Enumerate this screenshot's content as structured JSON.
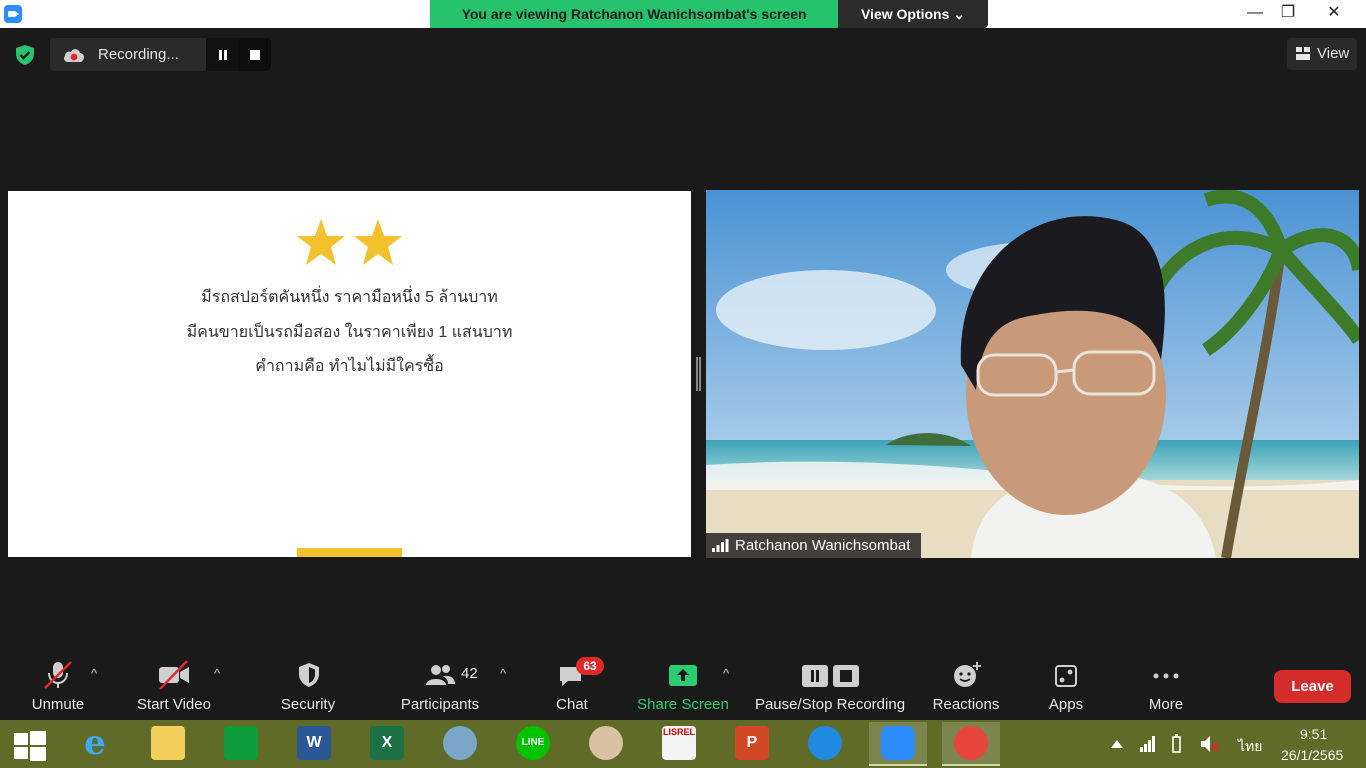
{
  "window": {
    "banner_text": "You are viewing Ratchanon Wanichsombat's screen",
    "view_options_label": "View Options ⌄",
    "minimize_glyph": "—",
    "maximize_glyph": "❐",
    "close_glyph": "✕"
  },
  "recording": {
    "label": "Recording...",
    "icons": [
      "security-shield-icon",
      "cloud-recording-icon",
      "pause-icon",
      "stop-icon"
    ]
  },
  "view_button": {
    "label": "View"
  },
  "shared_slide": {
    "star_count": 2,
    "lines": [
      "มีรถสปอร์ตคันหนึ่ง ราคามือหนึ่ง 5 ล้านบาท",
      "มีคนขายเป็นรถมือสอง ในราคาเพียง 1 แสนบาท",
      "คำถามคือ ทำไมไม่มีใครซื้อ"
    ],
    "accent_color": "#f3c12b"
  },
  "video": {
    "participant_name": "Ratchanon Wanichsombat"
  },
  "toolbar": {
    "unmute": "Unmute",
    "start_video": "Start Video",
    "security": "Security",
    "participants": "Participants",
    "participants_count": "42",
    "chat": "Chat",
    "chat_badge": "63",
    "share_screen": "Share Screen",
    "pause_stop_recording": "Pause/Stop Recording",
    "reactions": "Reactions",
    "apps": "Apps",
    "more": "More",
    "leave": "Leave",
    "caret": "^",
    "share_color": "#2ecc71",
    "leave_color": "#d42b2b"
  },
  "taskbar": {
    "apps": [
      "windows-start",
      "internet-explorer",
      "file-explorer",
      "store",
      "word",
      "excel",
      "math-input",
      "line",
      "paint",
      "lisrel",
      "powerpoint",
      "edge",
      "zoom",
      "chrome"
    ],
    "language": "ไทย",
    "time": "9:51",
    "date": "26/1/2565",
    "w_letter": "W",
    "x_letter": "X",
    "p_letter": "P",
    "line_text": "LINE",
    "lisrel_text": "LISREL"
  }
}
